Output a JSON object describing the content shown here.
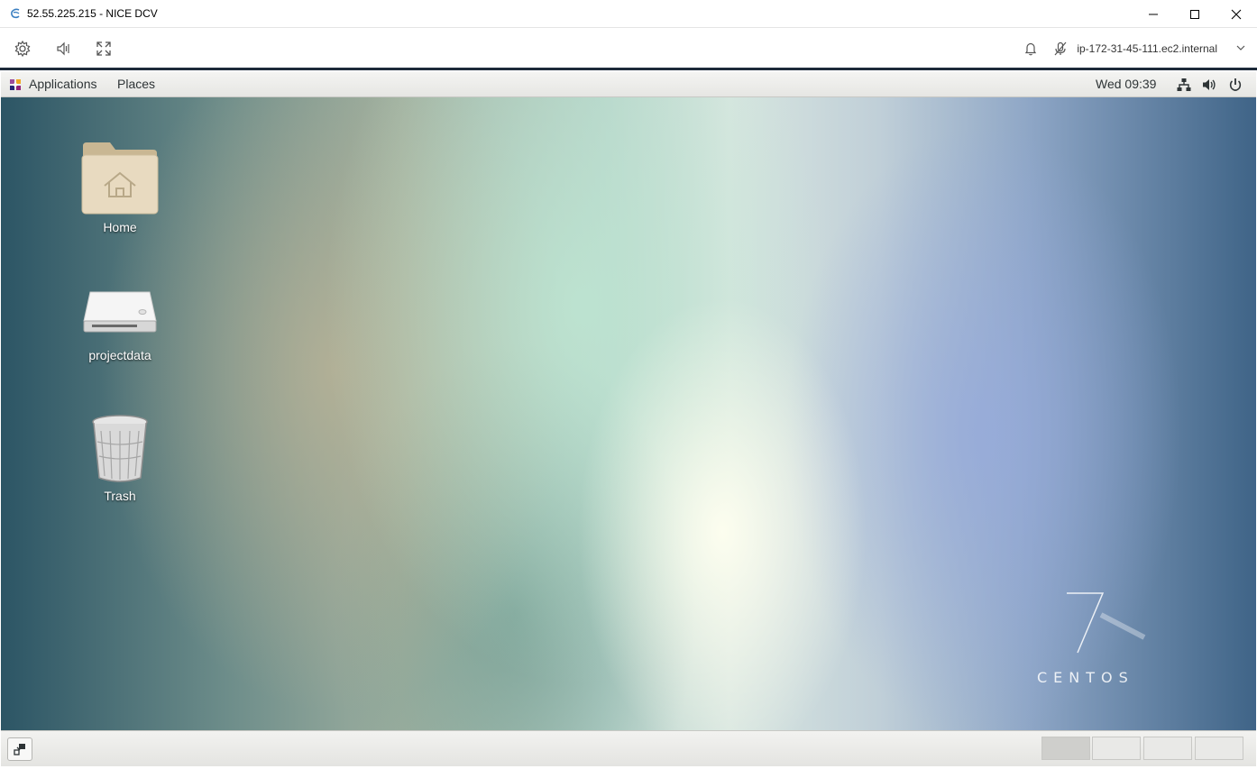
{
  "window": {
    "title": "52.55.225.215 - NICE DCV"
  },
  "toolbar": {
    "icons": [
      "gear-icon",
      "audio-icon",
      "fullscreen-icon",
      "bell-icon",
      "mic-off-icon",
      "chevron-down-icon"
    ],
    "host": "ip-172-31-45-111.ec2.internal"
  },
  "topbar": {
    "applications": "Applications",
    "places": "Places",
    "clock": "Wed 09:39",
    "tray": [
      "network-icon",
      "volume-icon",
      "power-icon"
    ]
  },
  "desktop": {
    "icons": [
      {
        "label": "Home",
        "icon": "home-folder-icon"
      },
      {
        "label": "projectdata",
        "icon": "drive-icon"
      },
      {
        "label": "Trash",
        "icon": "trash-icon"
      }
    ],
    "watermark": {
      "number": "7",
      "word": "CENTOS"
    }
  },
  "bottombar": {
    "workspaces": 4,
    "active_workspace": 1
  },
  "colors": {
    "toolbar_border": "#1d2a3a",
    "panel": "#e8e8e5"
  }
}
